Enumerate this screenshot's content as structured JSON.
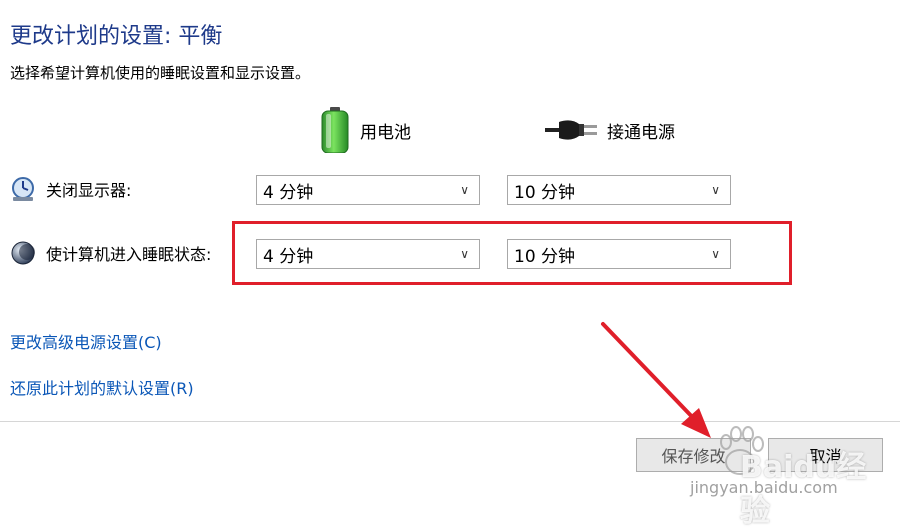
{
  "header": {
    "title": "更改计划的设置: 平衡",
    "subtitle": "选择希望计算机使用的睡眠设置和显示设置。"
  },
  "columns": {
    "battery": {
      "label": "用电池",
      "icon": "battery-icon"
    },
    "plugged": {
      "label": "接通电源",
      "icon": "power-plug-icon"
    }
  },
  "settings": [
    {
      "label": "关闭显示器:",
      "icon": "monitor-clock-icon",
      "battery": "4 分钟",
      "plugged": "10 分钟"
    },
    {
      "label": "使计算机进入睡眠状态:",
      "icon": "moon-sleep-icon",
      "battery": "4 分钟",
      "plugged": "10 分钟"
    }
  ],
  "links": {
    "advanced": "更改高级电源设置(C)",
    "restore": "还原此计划的默认设置(R)"
  },
  "buttons": {
    "save": "保存修改",
    "cancel": "取消"
  },
  "watermark": {
    "brand": "Baidu经验",
    "url": "jingyan.baidu.com"
  },
  "colors": {
    "title": "#1e3a8a",
    "link": "#0b57b7",
    "highlight": "#e01f2a",
    "battery_green": "#3cb043"
  }
}
